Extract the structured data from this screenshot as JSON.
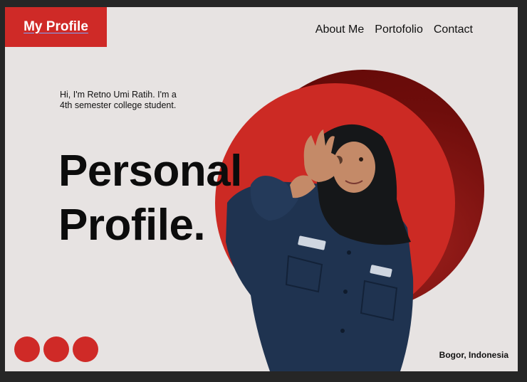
{
  "header": {
    "logo_text": "My Profile",
    "nav": [
      {
        "label": "About Me"
      },
      {
        "label": "Portofolio"
      },
      {
        "label": "Contact"
      }
    ]
  },
  "hero": {
    "intro": "Hi, I'm Retno Umi Ratih. I'm a 4th semester college student.",
    "headline_line1": "Personal",
    "headline_line2": "Profile."
  },
  "footer": {
    "location": "Bogor, Indonesia",
    "dots_count": 3
  },
  "colors": {
    "accent": "#cf2a27",
    "accent_dark": "#6e0d0b",
    "background": "#e7e3e2",
    "frame": "#262626"
  },
  "icons": [
    "profile-photo"
  ]
}
